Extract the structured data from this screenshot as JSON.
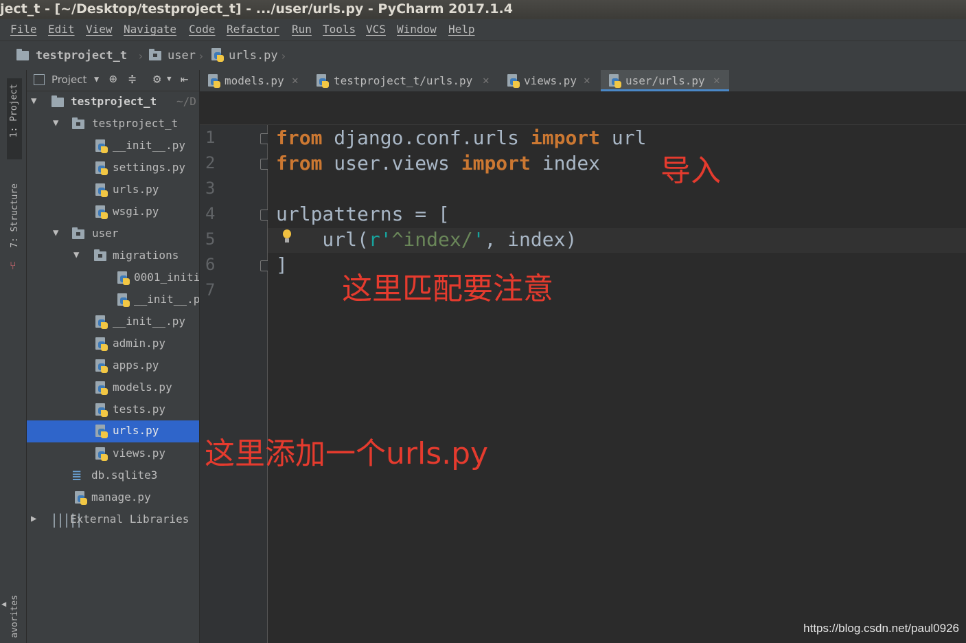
{
  "window": {
    "title": "ject_t - [~/Desktop/testproject_t] - .../user/urls.py - PyCharm 2017.1.4"
  },
  "menu": [
    "File",
    "Edit",
    "View",
    "Navigate",
    "Code",
    "Refactor",
    "Run",
    "Tools",
    "VCS",
    "Window",
    "Help"
  ],
  "navbar": {
    "crumbs": [
      "testproject_t",
      "user",
      "urls.py"
    ]
  },
  "left_strip": {
    "project_tab": "1: Project",
    "structure_tab": "7: Structure",
    "favorites_tab": "avorites"
  },
  "project_panel": {
    "header_label": "Project",
    "tree": [
      {
        "label": "testproject_t",
        "suffix": "~/D",
        "type": "root-folder"
      },
      {
        "label": "testproject_t",
        "type": "folder"
      },
      {
        "label": "__init__.py",
        "type": "py"
      },
      {
        "label": "settings.py",
        "type": "py"
      },
      {
        "label": "urls.py",
        "type": "py"
      },
      {
        "label": "wsgi.py",
        "type": "py"
      },
      {
        "label": "user",
        "type": "folder"
      },
      {
        "label": "migrations",
        "type": "folder"
      },
      {
        "label": "0001_initi",
        "type": "py"
      },
      {
        "label": "__init__.p",
        "type": "py"
      },
      {
        "label": "__init__.py",
        "type": "py"
      },
      {
        "label": "admin.py",
        "type": "py"
      },
      {
        "label": "apps.py",
        "type": "py"
      },
      {
        "label": "models.py",
        "type": "py"
      },
      {
        "label": "tests.py",
        "type": "py"
      },
      {
        "label": "urls.py",
        "type": "py",
        "selected": true
      },
      {
        "label": "views.py",
        "type": "py"
      },
      {
        "label": "db.sqlite3",
        "type": "db"
      },
      {
        "label": "manage.py",
        "type": "py"
      },
      {
        "label": "External Libraries",
        "type": "libs"
      }
    ]
  },
  "editor_tabs": [
    {
      "label": "models.py"
    },
    {
      "label": "testproject_t/urls.py"
    },
    {
      "label": "views.py"
    },
    {
      "label": "user/urls.py",
      "active": true
    }
  ],
  "gutter": {
    "line_numbers": [
      "1",
      "2",
      "3",
      "4",
      "5",
      "6",
      "7"
    ]
  },
  "code": {
    "l1": {
      "kw1": "from",
      "mod": " django.conf.urls ",
      "kw2": "import",
      "name": " url"
    },
    "l2": {
      "kw1": "from",
      "mod": " user.views ",
      "kw2": "import",
      "name": " index"
    },
    "l4": "urlpatterns = [",
    "l5": {
      "indent": "    url(",
      "r": "r",
      "q1": "'",
      "pattern": "^index/",
      "q2": "'",
      "rest": ", index)"
    },
    "l6": "]"
  },
  "annotations": {
    "import_note": "导入",
    "match_note": "这里匹配要注意",
    "add_note": "这里添加一个urls.py"
  },
  "watermark": "https://blog.csdn.net/paul0926",
  "colors": {
    "keyword": "#cc7832",
    "string": "#6a8759",
    "annotation": "#e53b2e",
    "selection": "#2f65ca"
  }
}
